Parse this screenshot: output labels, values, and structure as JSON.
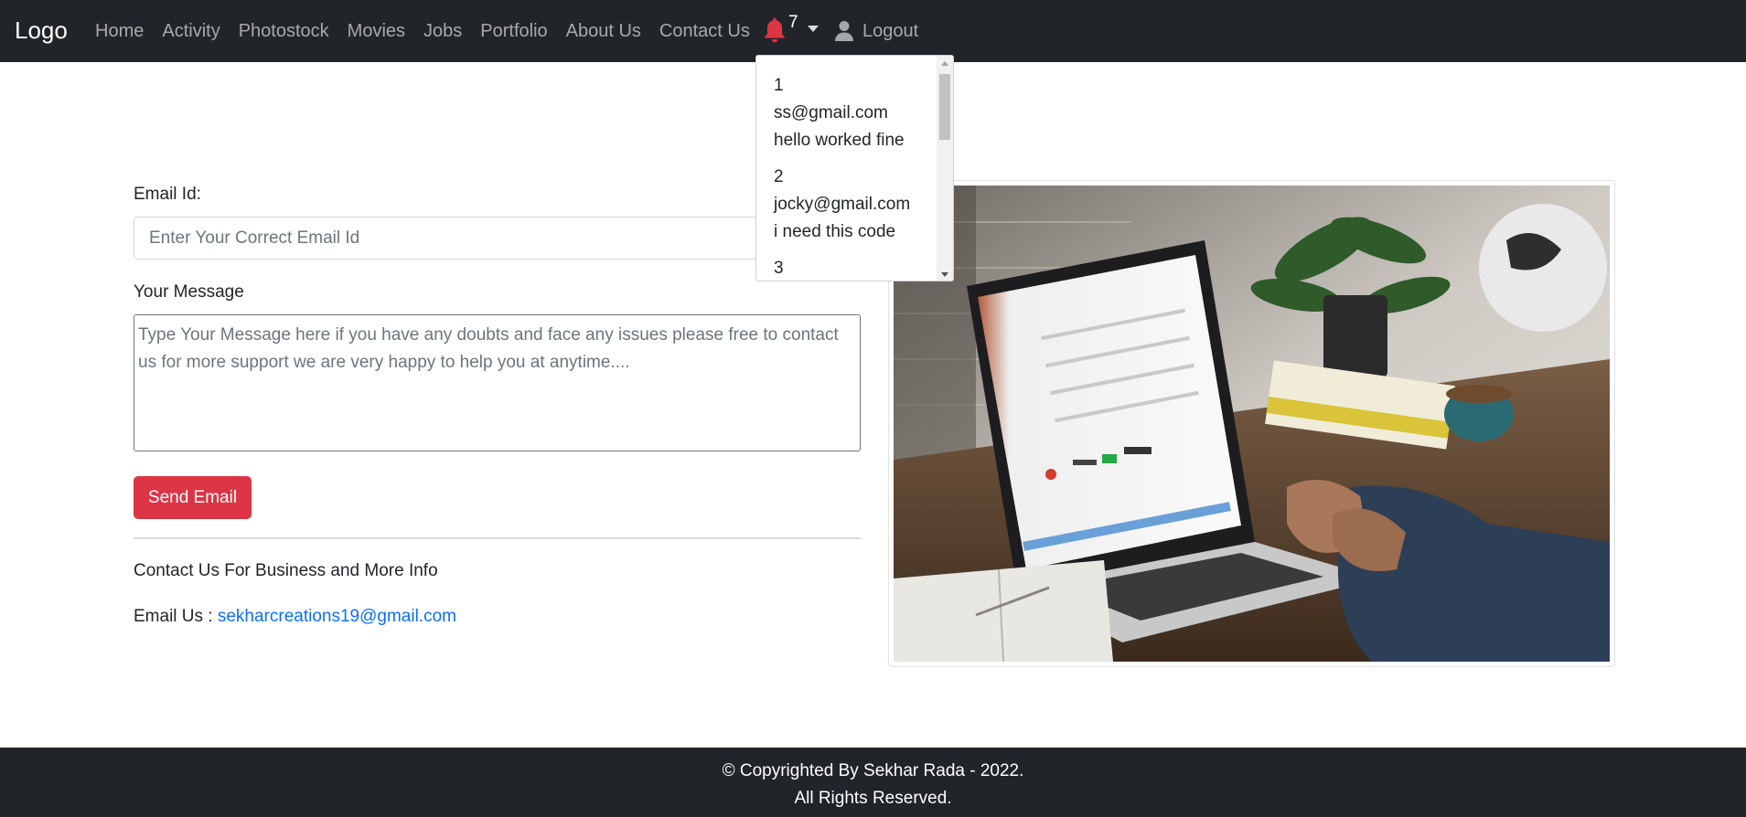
{
  "navbar": {
    "brand": "Logo",
    "links": [
      "Home",
      "Activity",
      "Photostock",
      "Movies",
      "Jobs",
      "Portfolio",
      "About Us",
      "Contact Us"
    ],
    "notification_count": "7",
    "logout_label": "Logout",
    "colors": {
      "background": "#212529",
      "bell": "#dc3545",
      "link": "rgba(255,255,255,0.6)"
    }
  },
  "notifications": {
    "items": [
      {
        "id": "1",
        "email": "ss@gmail.com",
        "message": "hello worked fine"
      },
      {
        "id": "2",
        "email": "jocky@gmail.com",
        "message": "i need this code"
      },
      {
        "id": "3"
      }
    ]
  },
  "form": {
    "email_label": "Email Id:",
    "email_placeholder": "Enter Your Correct Email Id",
    "message_label": "Your Message",
    "message_placeholder": "Type Your Message here if you have any doubts and face any issues please free to contact us for more support we are very happy to help you at anytime....",
    "send_label": "Send Email",
    "send_color": "#dc3545"
  },
  "contact": {
    "info_text": "Contact Us For Business and More Info",
    "email_prefix": "Email Us : ",
    "email": "sekharcreations19@gmail.com",
    "link_color": "#0d6efd"
  },
  "footer": {
    "line1": "© Copyrighted By Sekhar Rada - 2022.",
    "line2": "All Rights Reserved."
  }
}
